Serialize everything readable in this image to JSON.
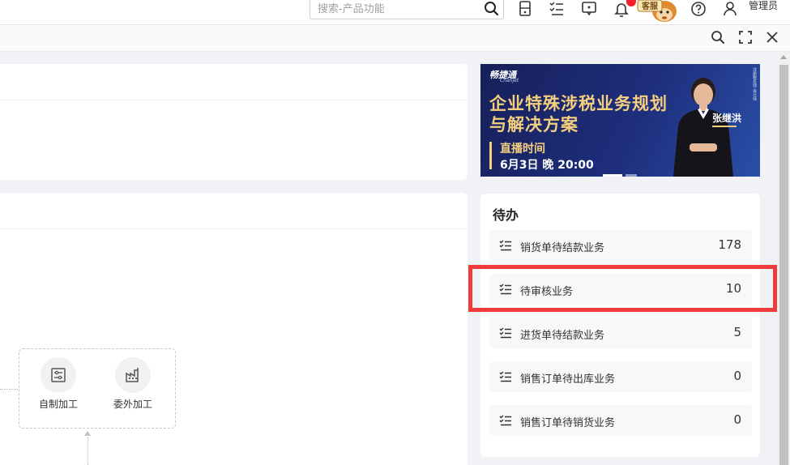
{
  "topbar": {
    "search_placeholder": "搜索-产品功能",
    "admin_label": "管理员",
    "mascot_text": "客服"
  },
  "cards": {
    "flow_items": [
      {
        "label": "自制加工",
        "icon": "factory-settings-icon"
      },
      {
        "label": "委外加工",
        "icon": "factory-building-icon"
      }
    ]
  },
  "banner": {
    "brand": "畅捷通",
    "brand_sub": "Chanjet",
    "title_line1": "企业特殊涉税业务规划",
    "title_line2": "与解决方案",
    "live_label": "直播时间",
    "live_time": "6月3日 晚 20:00",
    "speaker": "张继洪",
    "side_text": "注册税务师·会计师"
  },
  "todo": {
    "title": "待办",
    "items": [
      {
        "label": "销货单待结款业务",
        "count": "178"
      },
      {
        "label": "待审核业务",
        "count": "10"
      },
      {
        "label": "进货单待结款业务",
        "count": "5"
      },
      {
        "label": "销售订单待出库业务",
        "count": "0"
      },
      {
        "label": "销售订单待销货业务",
        "count": "0"
      }
    ]
  },
  "colors": {
    "accent_red": "#ef3b3b",
    "banner_gold": "#f4cf7e",
    "banner_blue": "#1e2e7c"
  }
}
